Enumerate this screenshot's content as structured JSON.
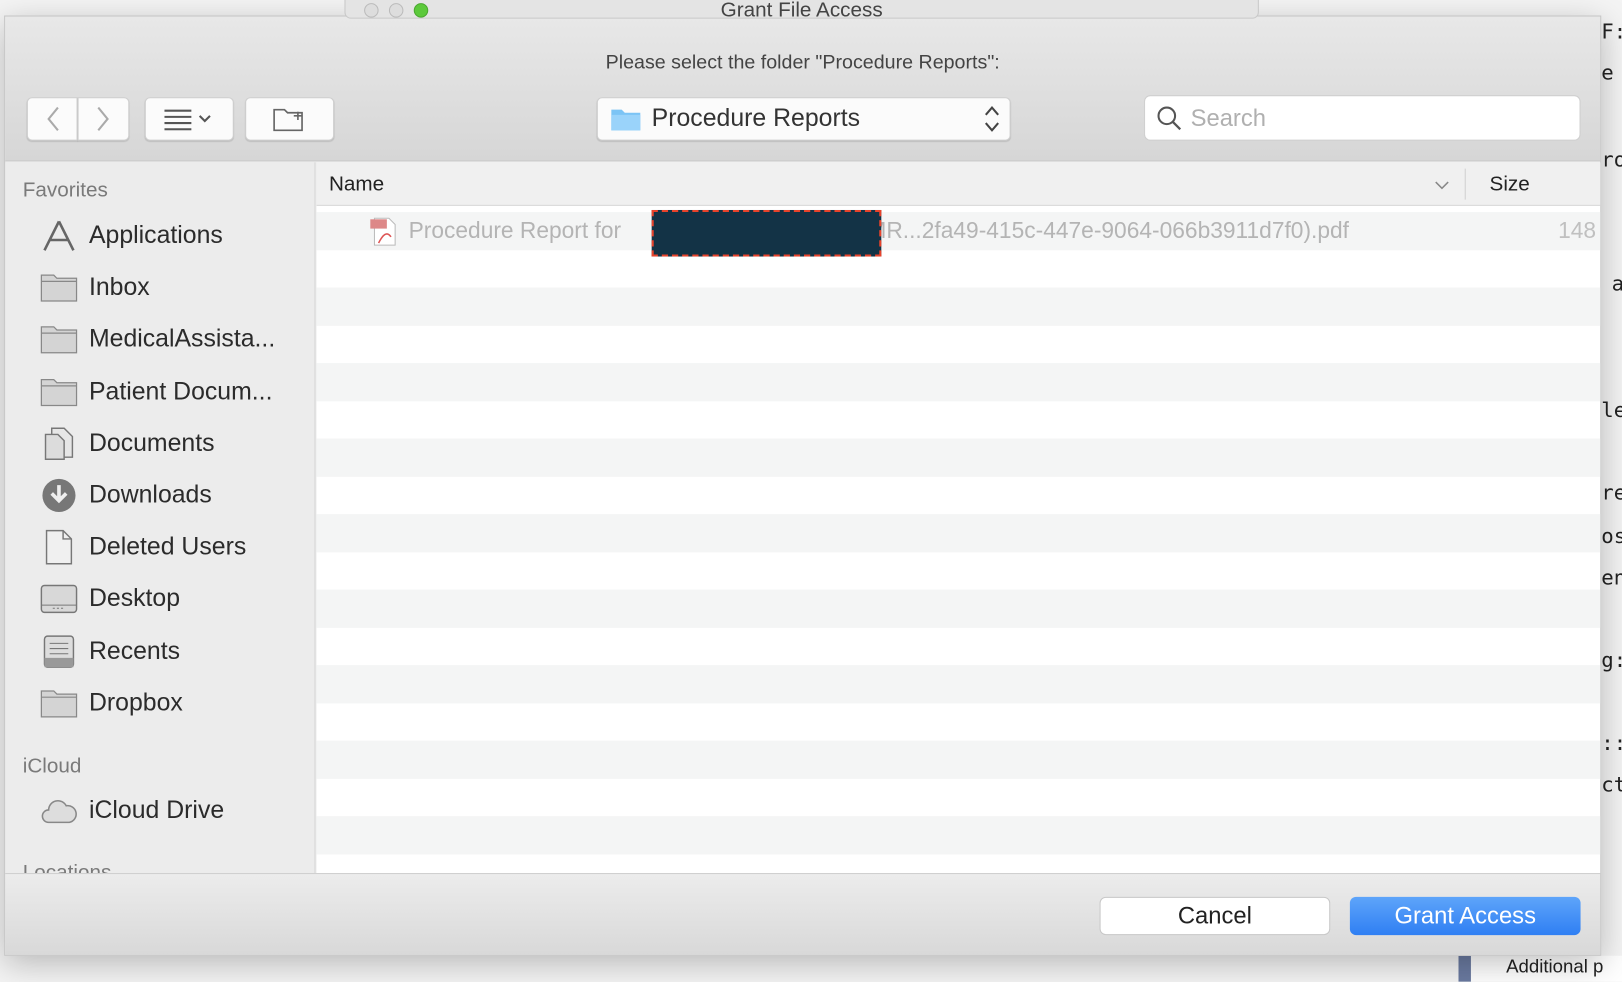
{
  "background": {
    "window_title": "Grant File Access",
    "code_fragments": [
      "F:",
      "e",
      "ro",
      "a",
      "le",
      "re",
      "os",
      "en",
      "g:",
      "::",
      "ct"
    ],
    "bottom_text": "Additional p"
  },
  "dialog": {
    "prompt": "Please select the folder \"Procedure Reports\":",
    "location": "Procedure Reports",
    "search_placeholder": "Search",
    "search_value": ""
  },
  "sidebar": {
    "favorites_label": "Favorites",
    "favorites": [
      {
        "label": "Applications",
        "icon": "applications-icon"
      },
      {
        "label": "Inbox",
        "icon": "folder-icon"
      },
      {
        "label": "MedicalAssista...",
        "icon": "folder-icon"
      },
      {
        "label": "Patient Docum...",
        "icon": "folder-icon"
      },
      {
        "label": "Documents",
        "icon": "documents-icon"
      },
      {
        "label": "Downloads",
        "icon": "downloads-icon"
      },
      {
        "label": "Deleted Users",
        "icon": "document-icon"
      },
      {
        "label": "Desktop",
        "icon": "desktop-icon"
      },
      {
        "label": "Recents",
        "icon": "recents-icon"
      },
      {
        "label": "Dropbox",
        "icon": "folder-icon"
      }
    ],
    "icloud_label": "iCloud",
    "icloud": [
      {
        "label": "iCloud Drive",
        "icon": "cloud-icon"
      }
    ],
    "locations_label": "Locations"
  },
  "list": {
    "columns": {
      "name": "Name",
      "size": "Size"
    },
    "files": [
      {
        "name_prefix": "Procedure Report for ",
        "name_suffix": "MR...2fa49-415c-447e-9064-066b3911d7f0).pdf",
        "size": "148",
        "icon": "pdf-icon",
        "redacted": true
      }
    ]
  },
  "buttons": {
    "cancel": "Cancel",
    "grant": "Grant Access"
  },
  "colors": {
    "accent": "#3a8cf7",
    "redaction": "#133346",
    "redaction_border": "#e8432b"
  }
}
